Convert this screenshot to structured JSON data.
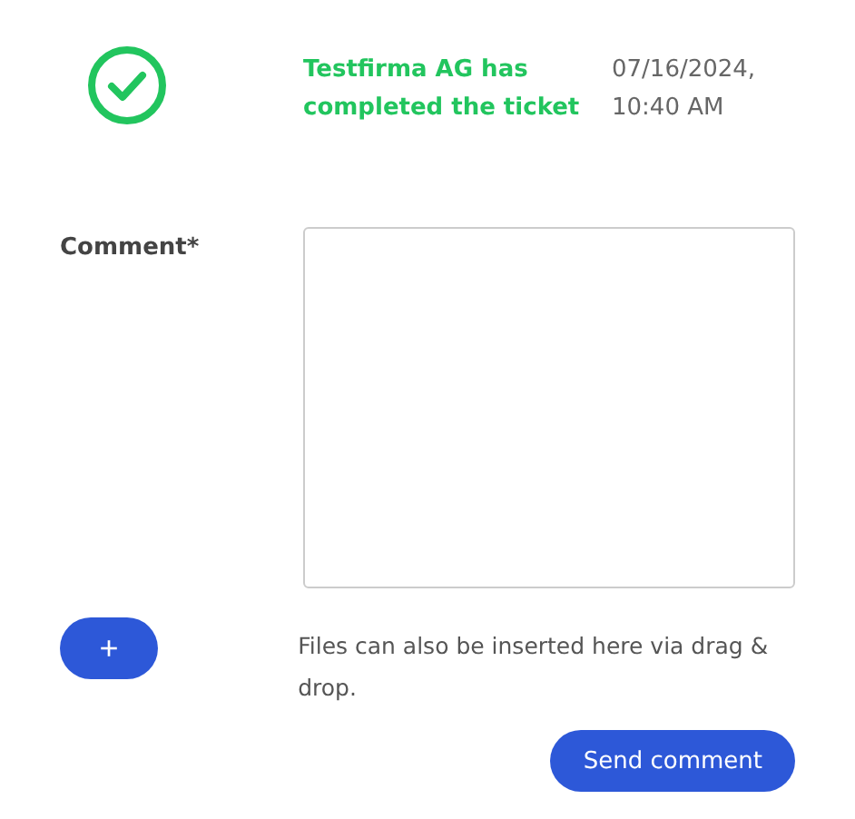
{
  "event": {
    "completed": true,
    "message": "Testfirma AG has completed the ticket",
    "date": "07/16/2024,",
    "time": "10:40 AM"
  },
  "comment": {
    "label": "Comment*"
  },
  "attach": {
    "button": "+",
    "hint": "Files can also be inserted here via drag & drop."
  },
  "submit": {
    "label": "Send comment"
  }
}
